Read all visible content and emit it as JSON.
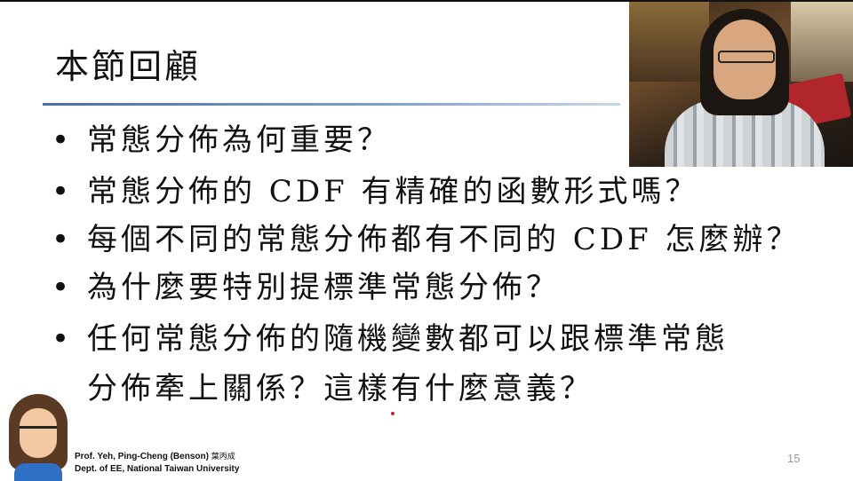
{
  "slide": {
    "title": "本節回顧",
    "bullets": [
      {
        "marker": "•",
        "text": "常態分佈為何重要？"
      },
      {
        "marker": "•",
        "text": "常態分佈的 CDF 有精確的函數形式嗎？"
      },
      {
        "marker": "•",
        "text": "每個不同的常態分佈都有不同的 CDF 怎麼辦？"
      },
      {
        "marker": "•",
        "text": "為什麼要特別提標準常態分佈？"
      },
      {
        "marker": "•",
        "text": "任何常態分佈的隨機變數都可以跟標準常態",
        "text2": "分佈牽上關係？這樣有什麼意義？"
      }
    ],
    "page_number": "15"
  },
  "footer": {
    "author_name": "Prof. Yeh, Ping-Cheng (Benson)",
    "author_signature": "葉丙成",
    "author_dept": "Dept. of EE,  National Taiwan University"
  },
  "colors": {
    "title_underline": "#4a6fa5",
    "text": "#111111",
    "page_number": "#999999"
  }
}
